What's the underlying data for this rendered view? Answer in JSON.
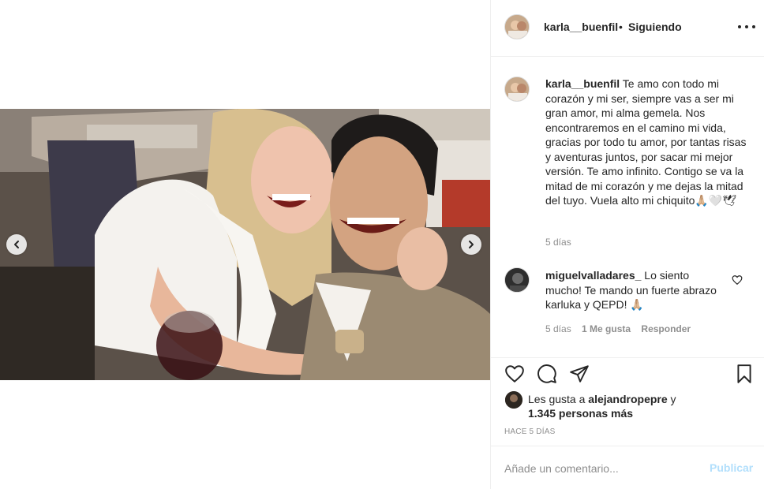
{
  "post": {
    "username": "karla__buenfil",
    "separator": "•",
    "follow_status": "Siguiendo",
    "more_icon": "more-horizontal-icon"
  },
  "caption": {
    "username": "karla__buenfil",
    "text": " Te amo con todo mi corazón y mi ser, siempre vas a ser mi gran amor, mi alma gemela. Nos encontraremos en el camino mi vida, gracias por todo tu amor, por tantas risas y aventuras juntos, por sacar mi mejor versión. Te amo infinito. Contigo se va la mitad de mi corazón y me dejas la mitad del tuyo. Vuela alto mi chiquito🙏🏼🤍🕊",
    "time": "5 días"
  },
  "comment": {
    "username": "miguelvalladares_",
    "text": " Lo siento mucho! Te mando un fuerte abrazo karluka y QEPD! 🙏🏼",
    "time": "5 días",
    "likes": "1 Me gusta",
    "reply": "Responder"
  },
  "likes": {
    "prefix": "Les gusta a ",
    "user": "alejandropepre",
    "and": " y",
    "others": "1.345 personas más"
  },
  "post_age": "HACE 5 DÍAS",
  "add_comment": {
    "placeholder": "Añade un comentario...",
    "publish": "Publicar"
  },
  "colors": {
    "text": "#262626",
    "muted": "#8e8e8e",
    "border": "#efefef",
    "publish_disabled": "#b2dffc"
  }
}
